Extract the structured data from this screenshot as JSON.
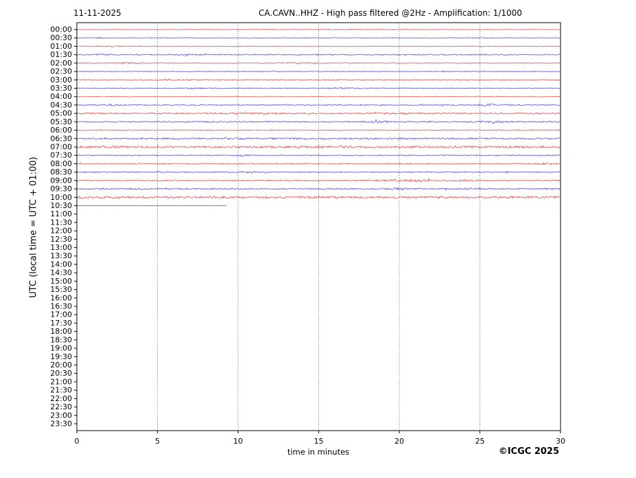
{
  "header": {
    "date": "11-11-2025",
    "title": "CA.CAVN..HHZ - High pass filtered @2Hz - Amplification: 1/1000"
  },
  "footer": {
    "credit": "©ICGC 2025"
  },
  "chart_data": {
    "type": "line",
    "subtype": "helicorder-dayplot",
    "station": "CA.CAVN..HHZ",
    "xlabel": "time in minutes",
    "ylabel": "UTC (local time = UTC + 01:00)",
    "x_range": [
      0,
      30
    ],
    "x_ticks": [
      0,
      5,
      10,
      15,
      20,
      25,
      30
    ],
    "grid_minutes": [
      5,
      10,
      15,
      20,
      25
    ],
    "grid_style": "dotted",
    "minutes_per_row": 30,
    "trace_colors": {
      "red": "#e05050",
      "blue": "#5050e0"
    },
    "data_coverage": "00:00 to about 10:39 UTC, later rows empty",
    "rows": [
      {
        "label": "00:00",
        "color": "red",
        "has_data": true,
        "amp": 0.45,
        "end_min": 30,
        "bursts": [
          [
            14,
            0.2,
            3
          ]
        ]
      },
      {
        "label": "00:30",
        "color": "blue",
        "has_data": true,
        "amp": 0.5,
        "end_min": 30,
        "bursts": [
          [
            1.3,
            0.5,
            0.3
          ]
        ]
      },
      {
        "label": "01:00",
        "color": "red",
        "has_data": true,
        "amp": 0.5,
        "end_min": 30,
        "bursts": [
          [
            2.2,
            0.45,
            0.5
          ]
        ]
      },
      {
        "label": "01:30",
        "color": "blue",
        "has_data": true,
        "amp": 0.75,
        "end_min": 30,
        "bursts": [
          [
            1.6,
            0.55,
            0.4
          ],
          [
            7,
            0.5,
            0.8
          ]
        ]
      },
      {
        "label": "02:00",
        "color": "red",
        "has_data": true,
        "amp": 0.55,
        "end_min": 30,
        "bursts": [
          [
            2.8,
            0.9,
            0.6
          ],
          [
            13.8,
            0.65,
            1.0
          ]
        ]
      },
      {
        "label": "02:30",
        "color": "blue",
        "has_data": true,
        "amp": 0.55,
        "end_min": 30,
        "bursts": []
      },
      {
        "label": "03:00",
        "color": "red",
        "has_data": true,
        "amp": 0.6,
        "end_min": 30,
        "bursts": [
          [
            5.5,
            0.3,
            1.2
          ]
        ]
      },
      {
        "label": "03:30",
        "color": "blue",
        "has_data": true,
        "amp": 0.6,
        "end_min": 30,
        "bursts": [
          [
            7.3,
            0.65,
            0.4
          ],
          [
            16.5,
            0.4,
            0.8
          ]
        ]
      },
      {
        "label": "04:00",
        "color": "red",
        "has_data": true,
        "amp": 0.5,
        "end_min": 30,
        "bursts": []
      },
      {
        "label": "04:30",
        "color": "blue",
        "has_data": true,
        "amp": 0.8,
        "end_min": 30,
        "bursts": [
          [
            2.1,
            0.9,
            0.4
          ],
          [
            25.5,
            0.9,
            0.6
          ]
        ]
      },
      {
        "label": "05:00",
        "color": "red",
        "has_data": true,
        "amp": 1.0,
        "end_min": 30,
        "bursts": [
          [
            11,
            0.35,
            2
          ],
          [
            20,
            0.3,
            2
          ]
        ]
      },
      {
        "label": "05:30",
        "color": "blue",
        "has_data": true,
        "amp": 0.9,
        "end_min": 30,
        "bursts": [
          [
            6.8,
            0.45,
            0.5
          ],
          [
            18.8,
            0.8,
            0.5
          ],
          [
            25.8,
            0.7,
            0.5
          ]
        ]
      },
      {
        "label": "06:00",
        "color": "red",
        "has_data": true,
        "amp": 0.7,
        "end_min": 30,
        "bursts": []
      },
      {
        "label": "06:30",
        "color": "blue",
        "has_data": true,
        "amp": 1.05,
        "end_min": 30,
        "bursts": [
          [
            10,
            0.3,
            3
          ],
          [
            22,
            0.35,
            2
          ]
        ]
      },
      {
        "label": "07:00",
        "color": "red",
        "has_data": true,
        "amp": 1.5,
        "end_min": 30,
        "bursts": [
          [
            3,
            0.3,
            1
          ]
        ]
      },
      {
        "label": "07:30",
        "color": "blue",
        "has_data": true,
        "amp": 0.7,
        "end_min": 30,
        "bursts": [
          [
            10.3,
            0.6,
            0.4
          ]
        ]
      },
      {
        "label": "08:00",
        "color": "red",
        "has_data": true,
        "amp": 0.8,
        "end_min": 30,
        "bursts": [
          [
            29.2,
            0.8,
            0.5
          ]
        ]
      },
      {
        "label": "08:30",
        "color": "blue",
        "has_data": true,
        "amp": 0.8,
        "end_min": 30,
        "bursts": [
          [
            10,
            0.4,
            0.5
          ]
        ]
      },
      {
        "label": "09:00",
        "color": "red",
        "has_data": true,
        "amp": 0.9,
        "end_min": 30,
        "bursts": [
          [
            20.5,
            1.1,
            1.0
          ],
          [
            24,
            0.5,
            0.9
          ]
        ]
      },
      {
        "label": "09:30",
        "color": "blue",
        "has_data": true,
        "amp": 0.9,
        "end_min": 30,
        "bursts": [
          [
            3.5,
            0.5,
            0.5
          ],
          [
            19.8,
            0.9,
            0.6
          ],
          [
            24.5,
            0.6,
            0.5
          ]
        ]
      },
      {
        "label": "10:00",
        "color": "red",
        "has_data": true,
        "amp": 1.55,
        "end_min": 30,
        "bursts": []
      },
      {
        "label": "10:30",
        "color": "blue",
        "has_data": true,
        "amp": 0.3,
        "end_min": 9.3,
        "bursts": []
      },
      {
        "label": "11:00",
        "color": null,
        "has_data": false
      },
      {
        "label": "11:30",
        "color": null,
        "has_data": false
      },
      {
        "label": "12:00",
        "color": null,
        "has_data": false
      },
      {
        "label": "12:30",
        "color": null,
        "has_data": false
      },
      {
        "label": "13:00",
        "color": null,
        "has_data": false
      },
      {
        "label": "13:30",
        "color": null,
        "has_data": false
      },
      {
        "label": "14:00",
        "color": null,
        "has_data": false
      },
      {
        "label": "14:30",
        "color": null,
        "has_data": false
      },
      {
        "label": "15:00",
        "color": null,
        "has_data": false
      },
      {
        "label": "15:30",
        "color": null,
        "has_data": false
      },
      {
        "label": "16:00",
        "color": null,
        "has_data": false
      },
      {
        "label": "16:30",
        "color": null,
        "has_data": false
      },
      {
        "label": "17:00",
        "color": null,
        "has_data": false
      },
      {
        "label": "17:30",
        "color": null,
        "has_data": false
      },
      {
        "label": "18:00",
        "color": null,
        "has_data": false
      },
      {
        "label": "18:30",
        "color": null,
        "has_data": false
      },
      {
        "label": "19:00",
        "color": null,
        "has_data": false
      },
      {
        "label": "19:30",
        "color": null,
        "has_data": false
      },
      {
        "label": "20:00",
        "color": null,
        "has_data": false
      },
      {
        "label": "20:30",
        "color": null,
        "has_data": false
      },
      {
        "label": "21:00",
        "color": null,
        "has_data": false
      },
      {
        "label": "21:30",
        "color": null,
        "has_data": false
      },
      {
        "label": "22:00",
        "color": null,
        "has_data": false
      },
      {
        "label": "22:30",
        "color": null,
        "has_data": false
      },
      {
        "label": "23:00",
        "color": null,
        "has_data": false
      },
      {
        "label": "23:30",
        "color": null,
        "has_data": false
      }
    ]
  }
}
